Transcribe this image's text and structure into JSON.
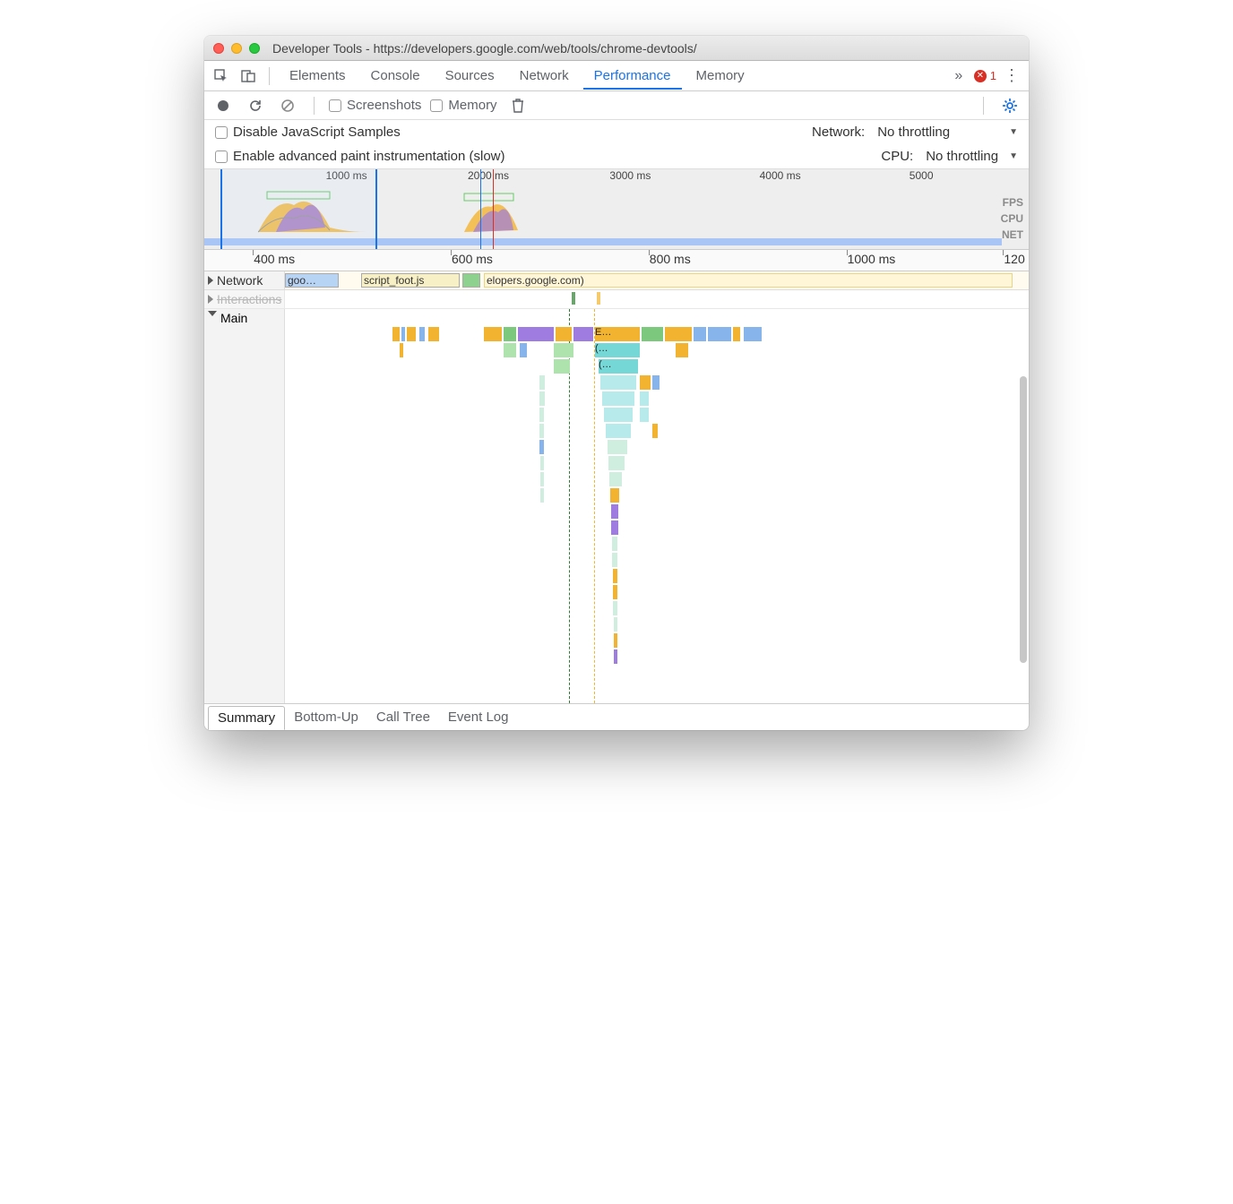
{
  "window": {
    "title": "Developer Tools - https://developers.google.com/web/tools/chrome-devtools/"
  },
  "tabs": {
    "items": [
      "Elements",
      "Console",
      "Sources",
      "Network",
      "Performance",
      "Memory"
    ],
    "active": "Performance",
    "overflow_icon": "»",
    "error_count": "1"
  },
  "toolbar": {
    "screenshots_label": "Screenshots",
    "memory_label": "Memory"
  },
  "settings": {
    "disable_js_label": "Disable JavaScript Samples",
    "enable_paint_label": "Enable advanced paint instrumentation (slow)",
    "network_label": "Network:",
    "network_value": "No throttling",
    "cpu_label": "CPU:",
    "cpu_value": "No throttling"
  },
  "overview": {
    "ticks": [
      "1000 ms",
      "2000 ms",
      "3000 ms",
      "4000 ms",
      "5000"
    ],
    "lanes": [
      "FPS",
      "CPU",
      "NET"
    ]
  },
  "ruler": {
    "ticks": [
      "400 ms",
      "600 ms",
      "800 ms",
      "1000 ms",
      "120"
    ]
  },
  "tracks": {
    "network_label": "Network",
    "network_items": [
      "goo…",
      "script_foot.js",
      "elopers.google.com)"
    ],
    "interactions_label": "Interactions",
    "main_label": "Main",
    "flame_labels": [
      "E…",
      "(…",
      "(…"
    ]
  },
  "bottom_tabs": {
    "items": [
      "Summary",
      "Bottom-Up",
      "Call Tree",
      "Event Log"
    ],
    "active": "Summary"
  },
  "colors": {
    "script": "#f2b430",
    "render": "#9e7ce0",
    "paint": "#7cc87c",
    "system": "#87b4ea",
    "idle": "#76d7d7",
    "light": "#e6e6e6"
  }
}
